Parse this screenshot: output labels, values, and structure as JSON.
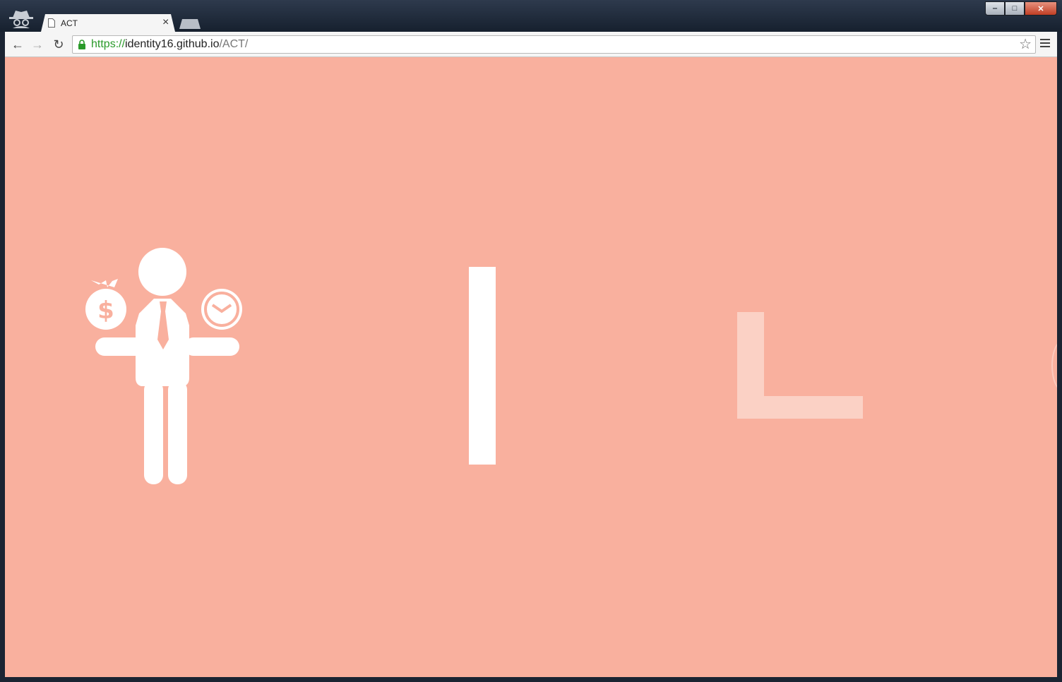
{
  "window": {
    "tab": {
      "title": "ACT",
      "close_glyph": "×"
    },
    "controls": {
      "minimize": "‒",
      "maximize": "□",
      "close": "✕"
    }
  },
  "toolbar": {
    "url": {
      "scheme": "https://",
      "host": "identity16.github.io",
      "path": "/ACT/"
    },
    "back_glyph": "←",
    "forward_glyph": "→",
    "reload_glyph": "↻",
    "star_glyph": "☆"
  },
  "page": {
    "background": "#f9b09e",
    "icons": [
      "businessman-money-time-icon",
      "incognito-icon"
    ],
    "letters": {
      "I": "white",
      "L": "#fbd1c5"
    }
  }
}
